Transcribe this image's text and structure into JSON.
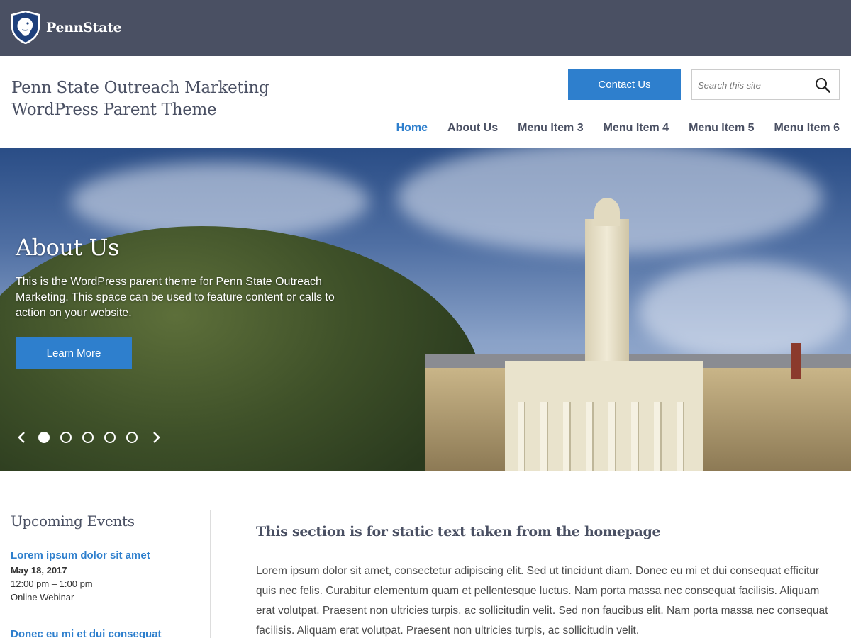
{
  "brand": {
    "name": "PennState",
    "logo_icon": "nittany-lion-shield-icon"
  },
  "header": {
    "site_title": "Penn State Outreach Marketing WordPress Parent Theme",
    "contact_label": "Contact Us",
    "search_placeholder": "Search this site",
    "nav": [
      "Home",
      "About Us",
      "Menu Item 3",
      "Menu Item 4",
      "Menu Item 5",
      "Menu Item 6"
    ],
    "active_nav": "Home"
  },
  "hero": {
    "title": "About Us",
    "body": "This is the WordPress parent theme for Penn State Outreach Marketing. This space can be used to feature content or calls to action on your website.",
    "button_label": "Learn More",
    "slide_count": 5,
    "active_slide": 1
  },
  "sidebar": {
    "title": "Upcoming Events",
    "events": [
      {
        "title": "Lorem ipsum dolor sit amet",
        "date": "May 18, 2017",
        "time": "12:00 pm – 1:00 pm",
        "location": "Online Webinar"
      },
      {
        "title": "Donec eu mi et dui consequat"
      }
    ]
  },
  "main": {
    "title": "This section is for static text taken from the homepage",
    "body": "Lorem ipsum dolor sit amet, consectetur adipiscing elit. Sed ut tincidunt diam. Donec eu mi et dui consequat efficitur quis nec felis. Curabitur elementum quam et pellentesque luctus. Nam porta massa nec consequat facilisis. Aliquam erat volutpat. Praesent non ultricies turpis, ac sollicitudin velit. Sed non faucibus elit. Nam porta massa nec consequat facilisis. Aliquam erat volutpat. Praesent non ultricies turpis, ac sollicitudin velit."
  },
  "colors": {
    "brand_bar": "#4a5063",
    "accent": "#2e7fcd",
    "heading": "#4a5063"
  }
}
